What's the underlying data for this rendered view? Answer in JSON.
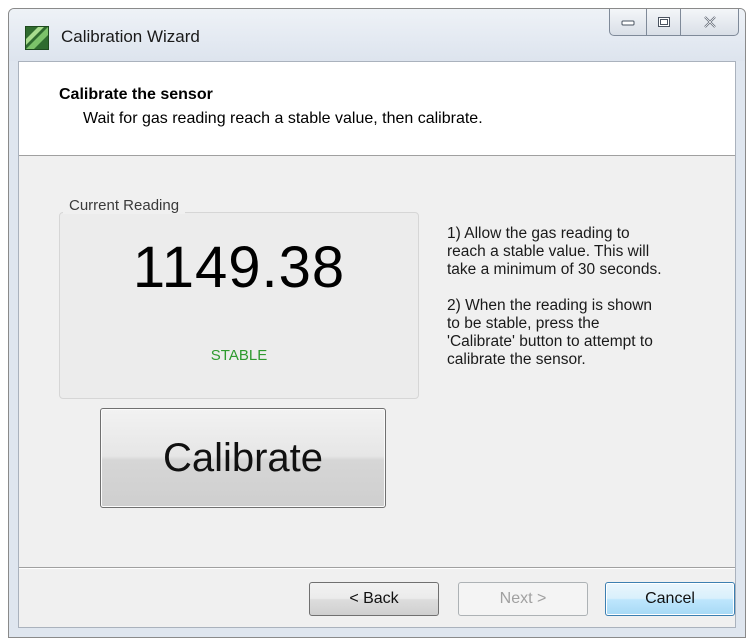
{
  "window": {
    "title": "Calibration Wizard",
    "icon": "app-icon",
    "caption_buttons": [
      "minimize-icon",
      "maximize-icon",
      "close-icon"
    ]
  },
  "header": {
    "title": "Calibrate the sensor",
    "subtitle": "Wait for gas reading reach a stable value, then calibrate."
  },
  "reading": {
    "group_label": "Current Reading",
    "value": "1149.38",
    "status": "STABLE",
    "status_color": "#2e9a2e"
  },
  "calibrate_button": {
    "label": "Calibrate"
  },
  "instructions": {
    "step1": "1) Allow the gas reading to\nreach a stable value. This will\ntake a minimum of 30 seconds.",
    "step2": "2) When the reading is shown\nto be stable, press the\n'Calibrate' button to attempt to\ncalibrate the sensor."
  },
  "footer": {
    "back_label": "< Back",
    "next_label": "Next >",
    "next_enabled": false,
    "cancel_label": "Cancel"
  },
  "colors": {
    "accent_focus": "#3c7fb1",
    "disabled_text": "#a0a0a0"
  }
}
